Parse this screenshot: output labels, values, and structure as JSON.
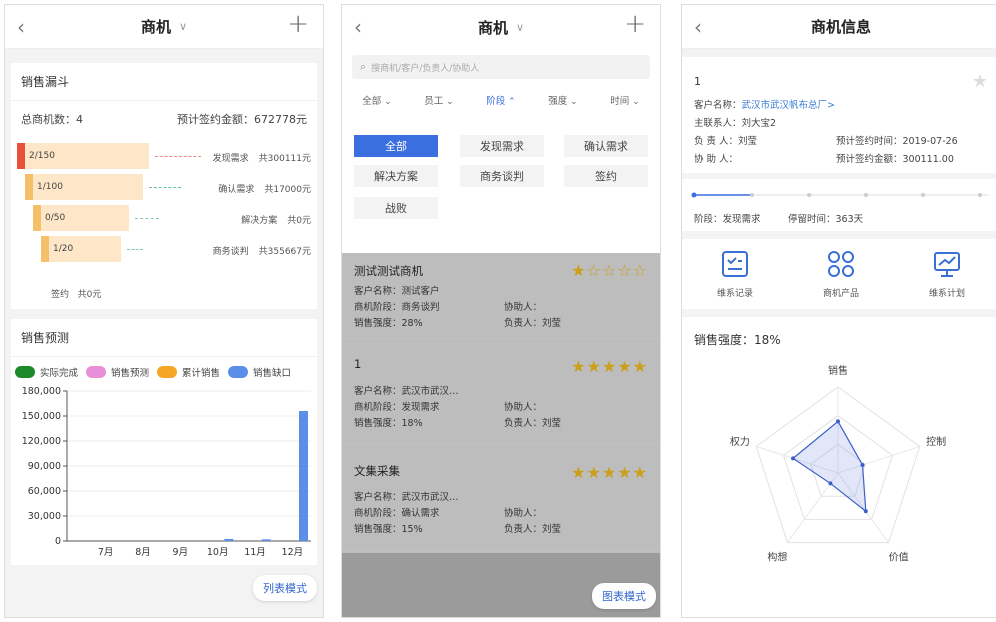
{
  "screen1": {
    "nav": {
      "title": "商机"
    },
    "funnel": {
      "section_title": "销售漏斗",
      "total_label": "总商机数：4",
      "amount_label": "预计签约金额：672778元",
      "rows": [
        {
          "ratio": "2/150",
          "stage": "发现需求",
          "amount": "共300111元",
          "color": "#e8503a"
        },
        {
          "ratio": "1/100",
          "stage": "确认需求",
          "amount": "共17000元",
          "color": "#f6c06a"
        },
        {
          "ratio": "0/50",
          "stage": "解决方案",
          "amount": "共0元",
          "color": "#f6c06a"
        },
        {
          "ratio": "1/20",
          "stage": "商务谈判",
          "amount": "共355667元",
          "color": "#f6c06a"
        }
      ],
      "sign_label": "签约",
      "sign_amount": "共0元"
    },
    "forecast": {
      "section_title": "销售预测",
      "legend": [
        {
          "name": "实际完成",
          "color": "#1a8a2a"
        },
        {
          "name": "销售预测",
          "color": "#e98fd8"
        },
        {
          "name": "累计销售",
          "color": "#f5a623"
        },
        {
          "name": "销售缺口",
          "color": "#5b8ee8"
        }
      ]
    },
    "mode_button": "列表模式"
  },
  "chart_data": {
    "type": "bar",
    "categories": [
      "7月",
      "8月",
      "9月",
      "10月",
      "11月",
      "12月"
    ],
    "series": [
      {
        "name": "销售缺口",
        "values": [
          0,
          0,
          0,
          2500,
          2000,
          156000
        ]
      }
    ],
    "yticks": [
      "180,000",
      "150,000",
      "120,000",
      "90,000",
      "60,000",
      "30,000",
      "0"
    ],
    "ylim": [
      0,
      180000
    ]
  },
  "screen2": {
    "nav": {
      "title": "商机"
    },
    "search_placeholder": "搜商机/客户/负责人/协助人",
    "filters": [
      "全部",
      "员工",
      "阶段",
      "强度",
      "时间"
    ],
    "stages": [
      "全部",
      "发现需求",
      "确认需求",
      "解决方案",
      "商务谈判",
      "签约",
      "战败"
    ],
    "items": [
      {
        "name": "测试测试商机",
        "customer": "客户名称：测试客户",
        "stage": "商机阶段：商务谈判",
        "assist": "协助人：",
        "strength": "销售强度：28%",
        "owner": "负责人：刘莹",
        "stars": "★☆☆☆☆"
      },
      {
        "name": "1",
        "customer": "客户名称：武汉市武汉…",
        "stage": "商机阶段：发现需求",
        "assist": "协助人：",
        "strength": "销售强度：18%",
        "owner": "负责人：刘莹",
        "stars": "★★★★★"
      },
      {
        "name": "文集采集",
        "customer": "客户名称：武汉市武汉…",
        "stage": "商机阶段：确认需求",
        "assist": "协助人：",
        "strength": "销售强度：15%",
        "owner": "负责人：刘莹",
        "stars": "★★★★★"
      }
    ],
    "mode_button": "图表模式"
  },
  "screen3": {
    "nav": {
      "title": "商机信息"
    },
    "name": "1",
    "customer_label": "客户名称：",
    "customer_value": "武汉市武汉帆布总厂>",
    "contact": "主联系人：刘大宝2",
    "owner": "负 责 人：刘莹",
    "assist": "协 助 人：",
    "sign_time": "预计签约时间：2019-07-26",
    "sign_amount": "预计签约金额：300111.00",
    "stage_info": "阶段：发现需求",
    "stay_time": "停留时间：363天",
    "actions": [
      {
        "label": "维系记录",
        "icon": "checklist-icon"
      },
      {
        "label": "商机产品",
        "icon": "grid-icon"
      },
      {
        "label": "维系计划",
        "icon": "chart-board-icon"
      }
    ],
    "strength": "销售强度：18%",
    "radar": {
      "axes": [
        "销售",
        "控制",
        "价值",
        "构想",
        "权力"
      ],
      "values": [
        0.6,
        0.3,
        0.55,
        0.15,
        0.55
      ]
    }
  }
}
